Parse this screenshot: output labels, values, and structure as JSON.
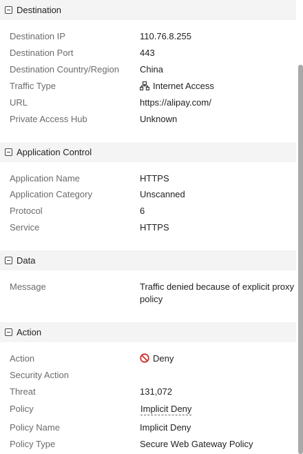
{
  "sections": {
    "destination": {
      "title": "Destination",
      "rows": {
        "dest_ip": {
          "label": "Destination IP",
          "value": "110.76.8.255"
        },
        "dest_port": {
          "label": "Destination Port",
          "value": "443"
        },
        "dest_country": {
          "label": "Destination Country/Region",
          "value": "China"
        },
        "traffic_type": {
          "label": "Traffic Type",
          "value": "Internet Access",
          "icon": "network-icon"
        },
        "url": {
          "label": "URL",
          "value": "https://alipay.com/"
        },
        "private_hub": {
          "label": "Private Access Hub",
          "value": "Unknown"
        }
      }
    },
    "application": {
      "title": "Application Control",
      "rows": {
        "app_name": {
          "label": "Application Name",
          "value": "HTTPS"
        },
        "app_category": {
          "label": "Application Category",
          "value": "Unscanned"
        },
        "protocol": {
          "label": "Protocol",
          "value": "6"
        },
        "service": {
          "label": "Service",
          "value": "HTTPS"
        }
      }
    },
    "data": {
      "title": "Data",
      "rows": {
        "message": {
          "label": "Message",
          "value": "Traffic denied because of explicit proxy policy"
        }
      }
    },
    "action": {
      "title": "Action",
      "rows": {
        "action": {
          "label": "Action",
          "value": "Deny",
          "icon": "deny-icon",
          "icon_color": "#d32f2f"
        },
        "security_action": {
          "label": "Security Action",
          "value": ""
        },
        "threat": {
          "label": "Threat",
          "value": "131,072"
        },
        "policy": {
          "label": "Policy",
          "value": "Implicit Deny"
        },
        "policy_name": {
          "label": "Policy Name",
          "value": "Implicit Deny"
        },
        "policy_type": {
          "label": "Policy Type",
          "value": "Secure Web Gateway Policy"
        }
      }
    }
  }
}
